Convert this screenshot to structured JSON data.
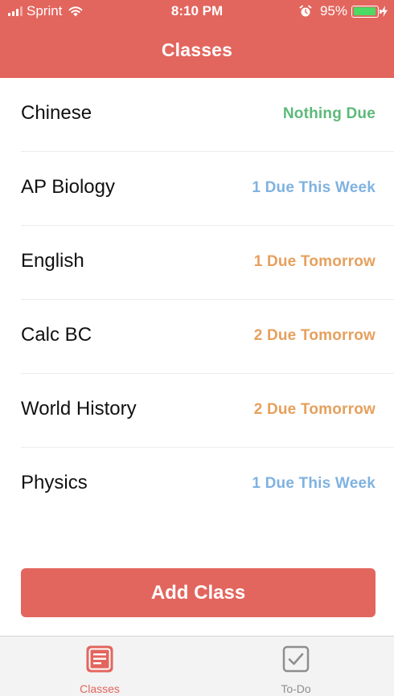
{
  "status_bar": {
    "carrier": "Sprint",
    "time": "8:10 PM",
    "battery_percent": "95%",
    "battery_level": 0.95
  },
  "header": {
    "title": "Classes"
  },
  "classes": [
    {
      "name": "Chinese",
      "status": "Nothing Due",
      "status_color": "#5cb97a"
    },
    {
      "name": "AP Biology",
      "status": "1 Due This Week",
      "status_color": "#7fb2e0"
    },
    {
      "name": "English",
      "status": "1 Due Tomorrow",
      "status_color": "#e6a05d"
    },
    {
      "name": "Calc BC",
      "status": "2 Due Tomorrow",
      "status_color": "#e6a05d"
    },
    {
      "name": "World History",
      "status": "2 Due Tomorrow",
      "status_color": "#e6a05d"
    },
    {
      "name": "Physics",
      "status": "1 Due This Week",
      "status_color": "#7fb2e0"
    }
  ],
  "add_button": {
    "label": "Add Class"
  },
  "tabbar": {
    "tabs": [
      {
        "label": "Classes",
        "icon": "classes-icon",
        "active": true
      },
      {
        "label": "To-Do",
        "icon": "checkbox-icon",
        "active": false
      }
    ]
  },
  "colors": {
    "accent": "#e2665e",
    "green": "#5cb97a",
    "blue": "#7fb2e0",
    "orange": "#e6a05d"
  }
}
